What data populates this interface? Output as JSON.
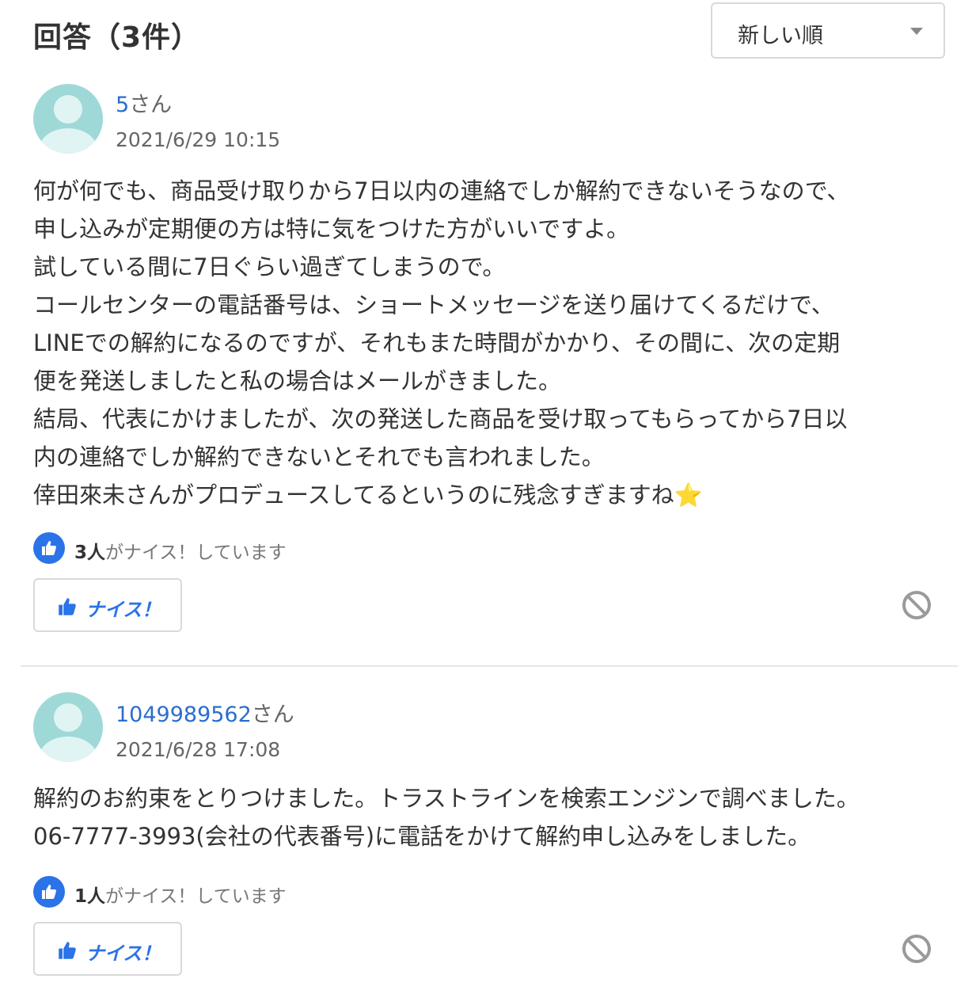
{
  "header": {
    "title": "回答（3件）",
    "sort": {
      "selected": "新しい順"
    }
  },
  "answers": [
    {
      "user_name": "5",
      "user_suffix": "さん",
      "date": "2021/6/29 10:15",
      "body": "何が何でも、商品受け取りから7日以内の連絡でしか解約できないそうなので、\n申し込みが定期便の方は特に気をつけた方がいいですよ。\n試している間に7日ぐらい過ぎてしまうので。\nコールセンターの電話番号は、ショートメッセージを送り届けてくるだけで、\nLINEでの解約になるのですが、それもまた時間がかかり、その間に、次の定期\n便を発送しましたと私の場合はメールがきました。\n結局、代表にかけましたが、次の発送した商品を受け取ってもらってから7日以\n内の連絡でしか解約できないとそれでも言われました。\n倖田來未さんがプロデュースしてるというのに残念すぎますね",
      "body_emoji": "⭐",
      "nice_count": "3人",
      "nice_suffix": "がナイス！しています",
      "nice_button": "ナイス！"
    },
    {
      "user_name": "1049989562",
      "user_suffix": "さん",
      "date": "2021/6/28 17:08",
      "body": "解約のお約束をとりつけました。トラストラインを検索エンジンで調べました。\n06-7777-3993(会社の代表番号)に電話をかけて解約申し込みをしました。",
      "nice_count": "1人",
      "nice_suffix": "がナイス！しています",
      "nice_button": "ナイス！"
    }
  ],
  "colors": {
    "link": "#2a6ed0",
    "accent": "#2a73e8",
    "avatar": "#9fd9d7",
    "text": "#333333",
    "muted": "#666666"
  },
  "icons": {
    "avatar": "default-user-avatar",
    "nice": "thumbs-up-icon",
    "report": "prohibited-icon",
    "sort": "chevron-down-icon"
  }
}
